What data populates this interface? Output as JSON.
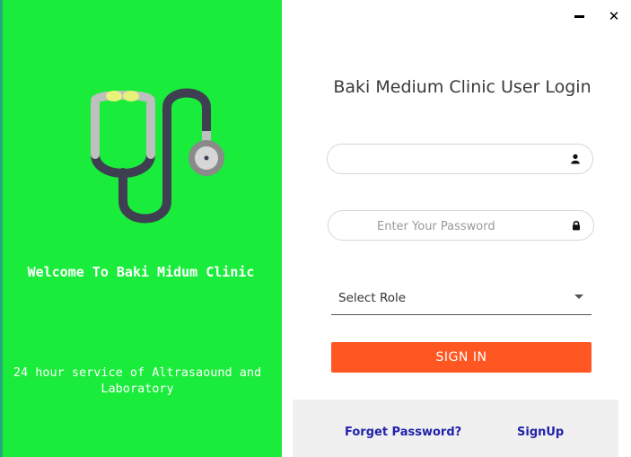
{
  "window": {
    "minimize_icon": "minimize-icon",
    "close_icon": "close-icon",
    "close_glyph": "✕"
  },
  "left_panel": {
    "logo_icon": "stethoscope-icon",
    "welcome_text": "Welcome To Baki Midum Clinic",
    "service_text": "24 hour service of Altrasaound and Laboratory",
    "background_color": "#19ec3a"
  },
  "login": {
    "title": "Baki Medium Clinic User Login",
    "username": {
      "value": "",
      "placeholder": "",
      "icon": "user-icon"
    },
    "password": {
      "value": "",
      "placeholder": "Enter Your Password",
      "icon": "lock-icon"
    },
    "role": {
      "selected": "Select Role",
      "icon": "chevron-down-icon"
    },
    "signin_label": "SIGN IN",
    "accent_color": "#ff5722"
  },
  "footer": {
    "forgot_label": "Forget Password?",
    "signup_label": "SignUp",
    "link_color": "#2222aa"
  }
}
